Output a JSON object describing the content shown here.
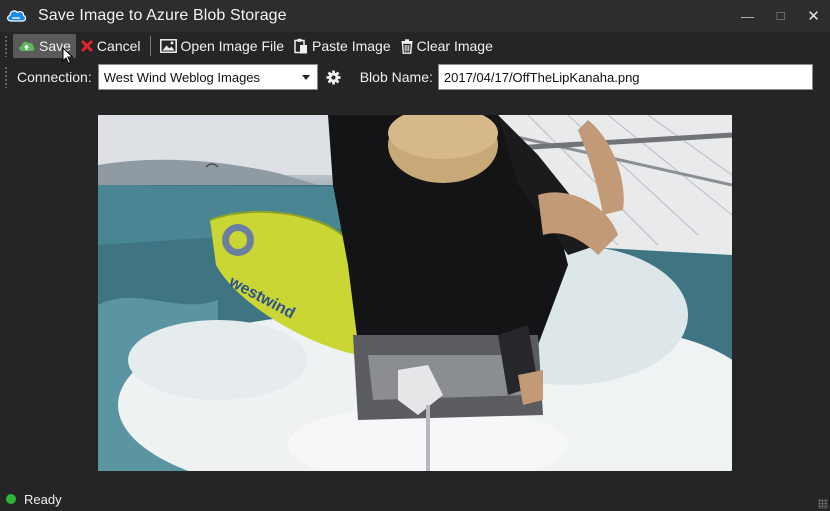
{
  "window": {
    "title": "Save Image to Azure Blob Storage",
    "minimize": "—",
    "maximize": "☐",
    "close": "✕"
  },
  "toolbar": {
    "save_label": "Save",
    "cancel_label": "Cancel",
    "open_label": "Open Image File",
    "paste_label": "Paste Image",
    "clear_label": "Clear Image"
  },
  "form": {
    "connection_label": "Connection:",
    "connection_value": "West Wind Weblog Images",
    "blob_label": "Blob Name:",
    "blob_value": "2017/04/17/OffTheLipKanaha.png"
  },
  "image": {
    "board_brand": "westwind"
  },
  "status": {
    "text": "Ready",
    "color": "#2fb53a"
  },
  "colors": {
    "save_icon": "#5cb85c",
    "cancel_icon": "#e0262b",
    "app_icon": "#1e88e5"
  }
}
